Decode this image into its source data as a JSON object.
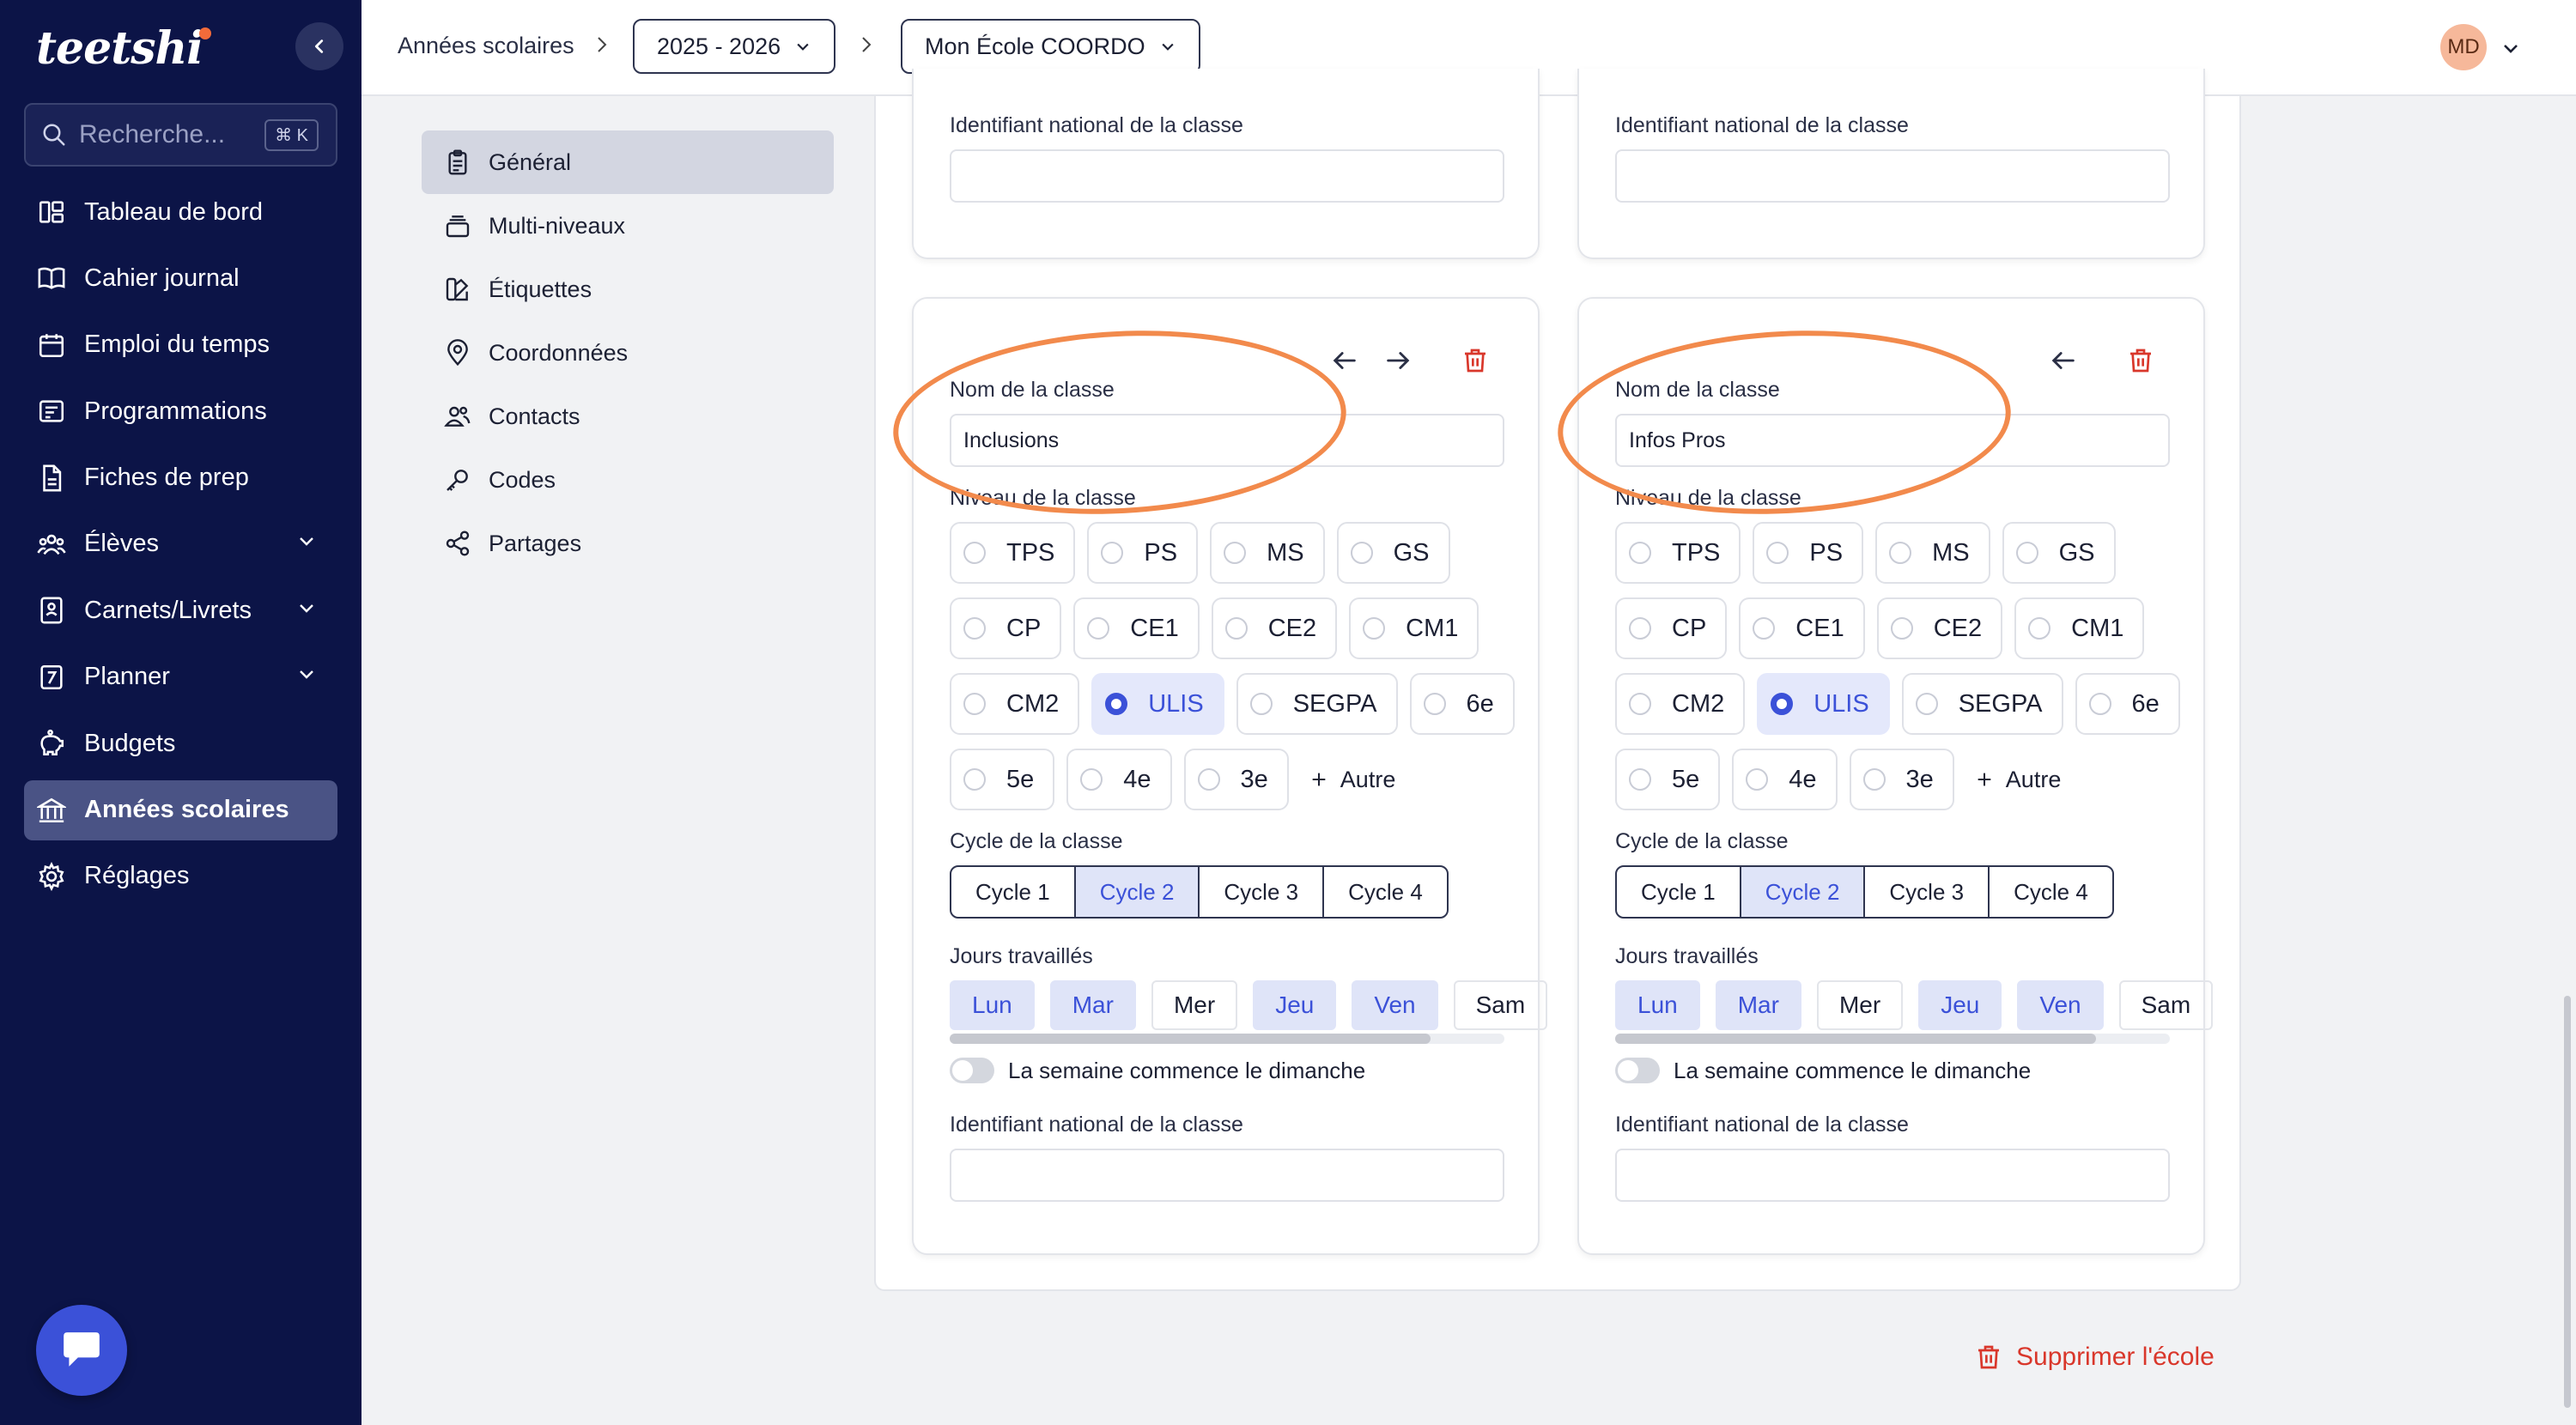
{
  "app": {
    "logo": "teetshi"
  },
  "search": {
    "placeholder": "Recherche...",
    "shortcut": "⌘ K"
  },
  "sidebar": {
    "items": [
      {
        "label": "Tableau de bord"
      },
      {
        "label": "Cahier journal"
      },
      {
        "label": "Emploi du temps"
      },
      {
        "label": "Programmations"
      },
      {
        "label": "Fiches de prep"
      },
      {
        "label": "Élèves"
      },
      {
        "label": "Carnets/Livrets"
      },
      {
        "label": "Planner"
      },
      {
        "label": "Budgets"
      },
      {
        "label": "Années scolaires"
      },
      {
        "label": "Réglages"
      }
    ],
    "active": "Années scolaires"
  },
  "breadcrumb": {
    "root": "Années scolaires",
    "year": "2025 - 2026",
    "school": "Mon École COORDO"
  },
  "user": {
    "initials": "MD"
  },
  "subnav": {
    "items": [
      {
        "label": "Général"
      },
      {
        "label": "Multi-niveaux"
      },
      {
        "label": "Étiquettes"
      },
      {
        "label": "Coordonnées"
      },
      {
        "label": "Contacts"
      },
      {
        "label": "Codes"
      },
      {
        "label": "Partages"
      }
    ],
    "active": "Général"
  },
  "labels": {
    "national_id": "Identifiant national de la classe",
    "class_name": "Nom de la classe",
    "class_level": "Niveau de la classe",
    "class_cycle": "Cycle de la classe",
    "work_days": "Jours travaillés",
    "week_sunday": "La semaine commence le dimanche",
    "autre": "Autre"
  },
  "levels": [
    "TPS",
    "PS",
    "MS",
    "GS",
    "CP",
    "CE1",
    "CE2",
    "CM1",
    "CM2",
    "ULIS",
    "SEGPA",
    "6e",
    "5e",
    "4e",
    "3e"
  ],
  "cycles": [
    "Cycle 1",
    "Cycle 2",
    "Cycle 3",
    "Cycle 4"
  ],
  "days": [
    "Lun",
    "Mar",
    "Mer",
    "Jeu",
    "Ven",
    "Sam"
  ],
  "classes": [
    {
      "name": "Inclusions",
      "selected_level": "ULIS",
      "selected_cycle": "Cycle 2",
      "active_days": [
        "Lun",
        "Mar",
        "Jeu",
        "Ven"
      ],
      "national_id": "",
      "week_starts_sunday": false
    },
    {
      "name": "Infos Pros",
      "selected_level": "ULIS",
      "selected_cycle": "Cycle 2",
      "active_days": [
        "Lun",
        "Mar",
        "Jeu",
        "Ven"
      ],
      "national_id": "",
      "week_starts_sunday": false
    }
  ],
  "danger": {
    "delete_school": "Supprimer l'école"
  },
  "colors": {
    "sidebar_bg": "#0c1447",
    "accent": "#3b51d8",
    "danger": "#d9372b",
    "annotation": "#f28a4c"
  }
}
